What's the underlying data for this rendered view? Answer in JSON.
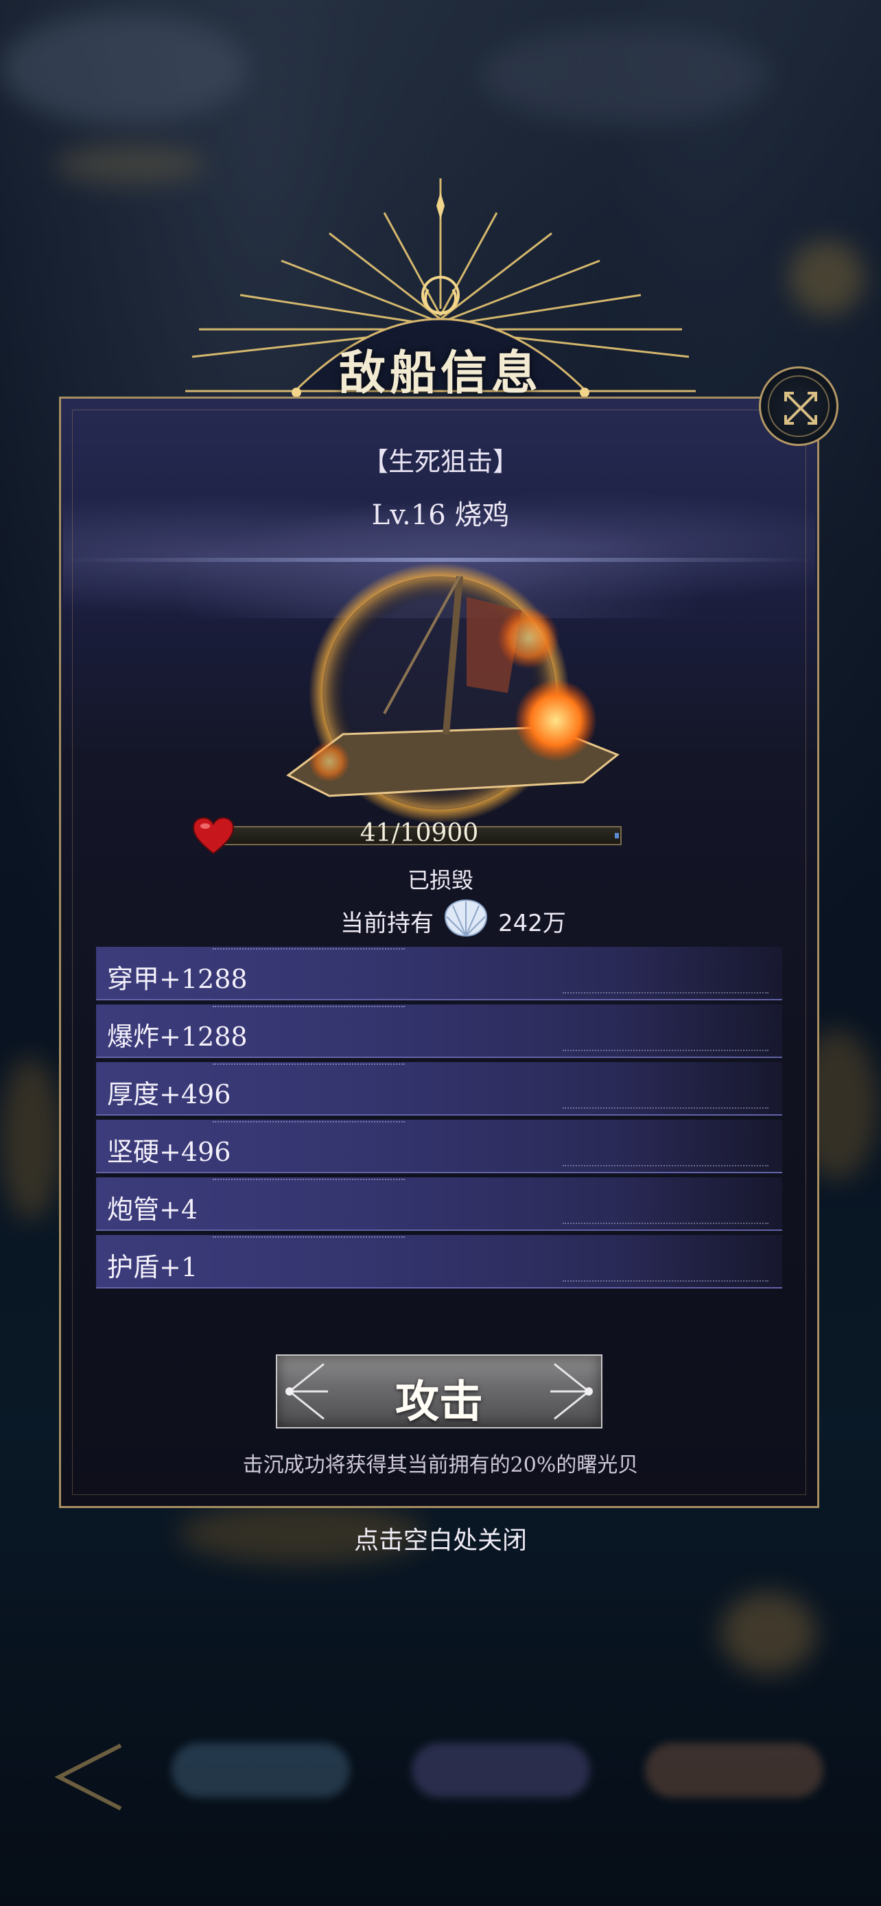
{
  "dialog": {
    "title": "敌船信息"
  },
  "enemy": {
    "skill": "【生死狙击】",
    "level_name": "Lv.16 烧鸡",
    "hp_current": 41,
    "hp_max": 10900,
    "hp_text": "41/10900",
    "status": "已损毁",
    "holding_label": "当前持有",
    "holding_value": "242万"
  },
  "stats": [
    "穿甲+1288",
    "爆炸+1288",
    "厚度+496",
    "坚硬+496",
    "炮管+4",
    "护盾+1"
  ],
  "actions": {
    "attack": "攻击",
    "reward_note": "击沉成功将获得其当前拥有的20%的曙光贝",
    "close_hint": "点击空白处关闭"
  },
  "colors": {
    "gold": "#d6b66e",
    "stat_row": "#3c3c7c",
    "hp_heart": "#c8161d"
  }
}
